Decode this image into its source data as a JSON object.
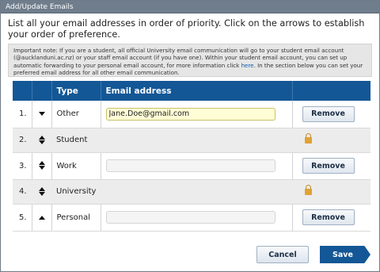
{
  "window": {
    "title": "Add/Update Emails"
  },
  "intro_text": "List all your email addresses in order of priority. Click on the arrows to establish your order of preference.",
  "note": {
    "before_link": "Important note: If you are a student, all official University email communication will go to your student email account (@aucklanduni.ac.nz) or your staff email account (if you have one). Within your student email account, you can set up automatic forwarding to your personal email account, for more information click ",
    "link_text": "here",
    "after_link": ". In the section below you can set your preferred email address for all other email communication."
  },
  "table": {
    "headers": {
      "num": "",
      "arrows": "",
      "type": "Type",
      "email": "Email address",
      "action": ""
    },
    "rows": [
      {
        "num": "1.",
        "type": "Other",
        "email": "Jane.Doe@gmail.com",
        "arrows": "down",
        "editable": true,
        "action": "Remove"
      },
      {
        "num": "2.",
        "type": "Student",
        "email": "",
        "arrows": "both",
        "editable": false,
        "locked": true
      },
      {
        "num": "3.",
        "type": "Work",
        "email": "",
        "arrows": "both",
        "editable": true,
        "action": "Remove"
      },
      {
        "num": "4.",
        "type": "University",
        "email": "",
        "arrows": "both",
        "editable": false,
        "locked": true
      },
      {
        "num": "5.",
        "type": "Personal",
        "email": "",
        "arrows": "up",
        "editable": true,
        "action": "Remove"
      }
    ]
  },
  "buttons": {
    "cancel": "Cancel",
    "save": "Save"
  },
  "colors": {
    "header_blue": "#135796",
    "titlebar": "#6f7d8c",
    "lock": "#e2a235"
  }
}
